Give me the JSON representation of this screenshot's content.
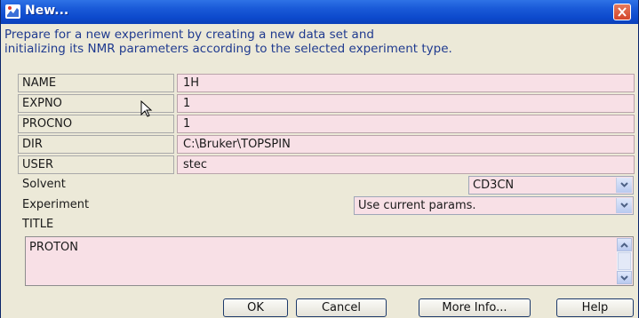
{
  "window": {
    "title": "New..."
  },
  "description": {
    "line1": "Prepare for a new experiment by creating a new data set and",
    "line2": "initializing its NMR parameters according to the selected experiment type."
  },
  "fields": {
    "name": {
      "label": "NAME",
      "value": "1H"
    },
    "expno": {
      "label": "EXPNO",
      "value": "1"
    },
    "procno": {
      "label": "PROCNO",
      "value": "1"
    },
    "dir": {
      "label": "DIR",
      "value": "C:\\Bruker\\TOPSPIN"
    },
    "user": {
      "label": "USER",
      "value": "stec"
    }
  },
  "solvent": {
    "label": "Solvent",
    "value": "CD3CN"
  },
  "experiment": {
    "label": "Experiment",
    "value": "Use current params."
  },
  "title_field": {
    "label": "TITLE",
    "value": "PROTON"
  },
  "buttons": {
    "ok": "OK",
    "cancel": "Cancel",
    "more_info": "More Info...",
    "help": "Help"
  },
  "icons": {
    "app": "topspin-app-icon",
    "close": "close-icon",
    "dropdown": "chevron-down-icon",
    "cursor": "mouse-pointer-icon"
  },
  "colors": {
    "titlebar": "#0c49cc",
    "field_bg": "#f8e0e6",
    "description_text": "#1f3a8f",
    "dialog_bg": "#ece9d8"
  }
}
